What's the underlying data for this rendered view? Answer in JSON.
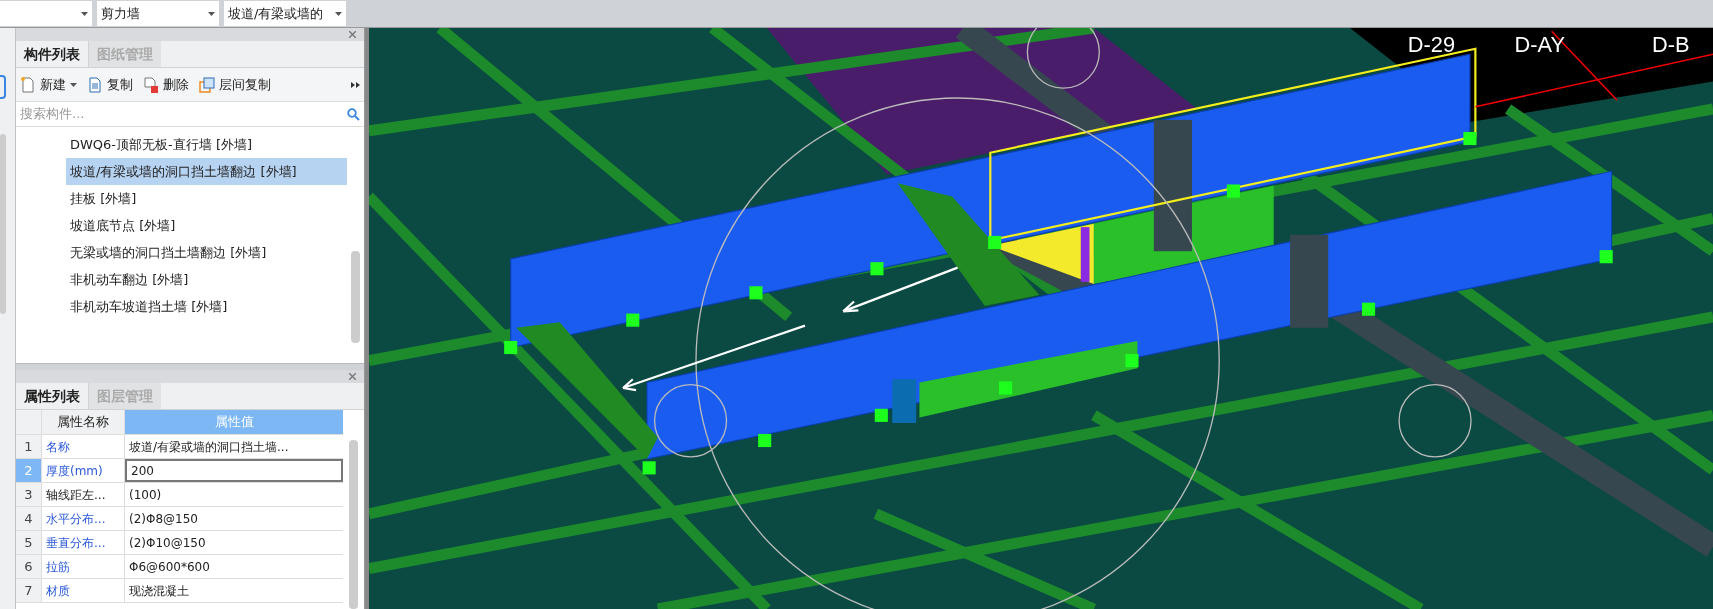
{
  "toolbar": {
    "dropdowns": [
      {
        "value": "剪力墙"
      },
      {
        "value": "坡道/有梁或墙的"
      }
    ]
  },
  "component_panel": {
    "tabs": [
      {
        "label": "构件列表",
        "selected": true
      },
      {
        "label": "图纸管理",
        "selected": false
      }
    ],
    "actions": [
      {
        "kind": "new",
        "label": "新建",
        "dropdown": true
      },
      {
        "kind": "copy",
        "label": "复制",
        "dropdown": false
      },
      {
        "kind": "delete",
        "label": "删除",
        "dropdown": false
      },
      {
        "kind": "floor-copy",
        "label": "层间复制",
        "dropdown": false
      }
    ],
    "search": {
      "placeholder": "搜索构件..."
    },
    "items": [
      {
        "label": "DWQ6-顶部无板-直行墙 [外墙]",
        "selected": false
      },
      {
        "label": "坡道/有梁或墙的洞口挡土墙翻边 [外墙]",
        "selected": true
      },
      {
        "label": "挂板 [外墙]",
        "selected": false
      },
      {
        "label": "坡道底节点 [外墙]",
        "selected": false
      },
      {
        "label": "无梁或墙的洞口挡土墙翻边 [外墙]",
        "selected": false
      },
      {
        "label": "非机动车翻边 [外墙]",
        "selected": false
      },
      {
        "label": "非机动车坡道挡土墙 [外墙]",
        "selected": false
      }
    ]
  },
  "property_panel": {
    "tabs": [
      {
        "label": "属性列表",
        "selected": true
      },
      {
        "label": "图层管理",
        "selected": false
      }
    ],
    "columns": [
      "属性名称",
      "属性值"
    ],
    "rows": [
      {
        "index": "1",
        "name": "名称",
        "value": "坡道/有梁或墙的洞口挡土墙...",
        "public": true,
        "selected": false
      },
      {
        "index": "2",
        "name": "厚度(mm)",
        "value": "200",
        "public": true,
        "selected": true
      },
      {
        "index": "3",
        "name": "轴线距左...",
        "value": "(100)",
        "public": false,
        "selected": false
      },
      {
        "index": "4",
        "name": "水平分布...",
        "value": "(2)Φ8@150",
        "public": true,
        "selected": false
      },
      {
        "index": "5",
        "name": "垂直分布...",
        "value": "(2)Φ10@150",
        "public": true,
        "selected": false
      },
      {
        "index": "6",
        "name": "拉筋",
        "value": "Φ6@600*600",
        "public": true,
        "selected": false
      },
      {
        "index": "7",
        "name": "材质",
        "value": "现浇混凝土",
        "public": true,
        "selected": false
      }
    ]
  },
  "viewport": {
    "axis_labels": [
      "D-29",
      "D-AY",
      "D-B"
    ]
  }
}
